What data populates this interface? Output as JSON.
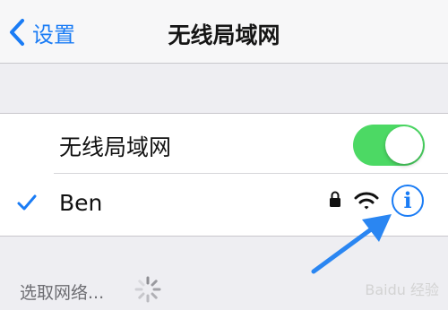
{
  "navbar": {
    "back_label": "设置",
    "title": "无线局域网"
  },
  "wifi_toggle": {
    "label": "无线局域网",
    "on": true
  },
  "connected_network": {
    "name": "Ben",
    "info_label": "i"
  },
  "choose_network": {
    "label": "选取网络..."
  },
  "watermark": "Baidu 经验",
  "colors": {
    "accent": "#1a7cf5",
    "toggle_on": "#4cd964",
    "background": "#eeeef2",
    "annotation_arrow": "#2a86f2"
  },
  "icons": {
    "back": "chevron-left-icon",
    "check": "checkmark-icon",
    "lock": "lock-icon",
    "signal": "wifi-signal-icon",
    "info": "info-icon",
    "loading": "spinner-icon"
  }
}
